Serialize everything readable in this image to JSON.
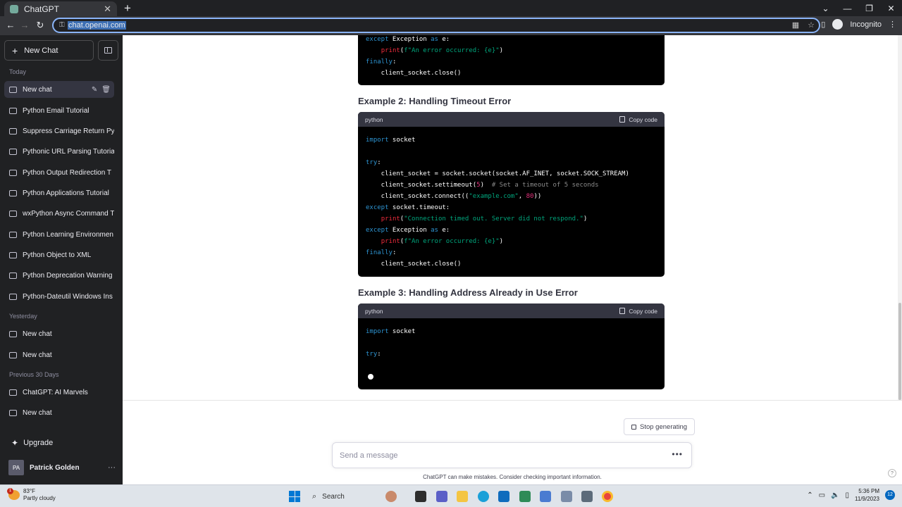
{
  "browser": {
    "tab_title": "ChatGPT",
    "url": "chat.openai.com",
    "incognito_label": "Incognito",
    "window_controls": [
      "⌄",
      "—",
      "❐",
      "✕"
    ]
  },
  "sidebar": {
    "new_chat_label": "New Chat",
    "sections": [
      {
        "label": "Today"
      },
      {
        "label": "Yesterday"
      },
      {
        "label": "Previous 30 Days"
      }
    ],
    "today_items": [
      "New chat",
      "Python Email Tutorial",
      "Suppress Carriage Return Py",
      "Pythonic URL Parsing Tutoria",
      "Python Output Redirection T",
      "Python Applications Tutorial",
      "wxPython Async Command T",
      "Python Learning Environmen",
      "Python Object to XML",
      "Python Deprecation Warning",
      "Python-Dateutil Windows Ins"
    ],
    "yesterday_items": [
      "New chat",
      "New chat"
    ],
    "previous_items": [
      "ChatGPT: AI Marvels",
      "New chat"
    ],
    "upgrade_label": "Upgrade",
    "user": {
      "initials": "PA",
      "name": "Patrick Golden"
    }
  },
  "main": {
    "heading2": "Example 2: Handling Timeout Error",
    "heading3": "Example 3: Handling Address Already in Use Error",
    "code_lang": "python",
    "copy_label": "Copy code",
    "stop_label": "Stop generating",
    "message_placeholder": "Send a message",
    "disclaimer": "ChatGPT can make mistakes. Consider checking important information.",
    "help_label": "?"
  },
  "taskbar": {
    "weather_temp": "83°F",
    "weather_desc": "Partly cloudy",
    "weather_badge": "1",
    "search_label": "Search",
    "time": "5:36 PM",
    "date": "11/9/2023",
    "notification_count": "12"
  }
}
